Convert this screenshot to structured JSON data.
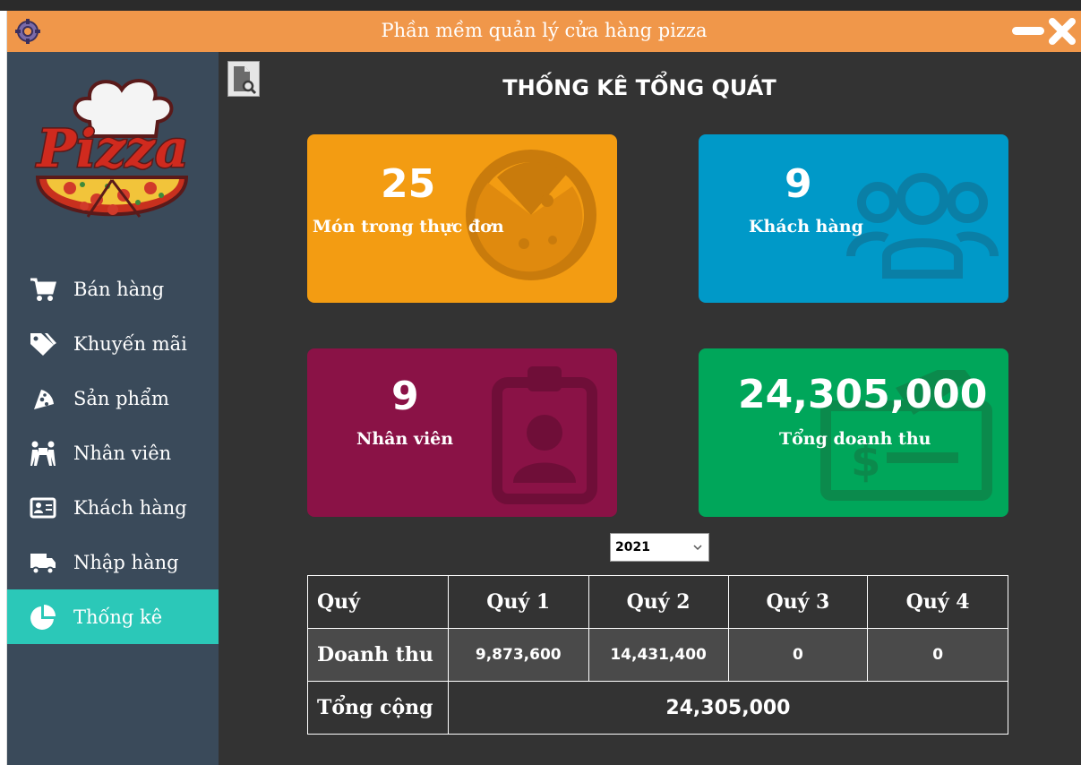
{
  "window": {
    "title": "Phần mềm quản lý cửa hàng pizza",
    "accent_color": "#f0974a"
  },
  "sidebar": {
    "logo_text": "Pizza",
    "items": [
      {
        "label": "Bán hàng",
        "icon": "shopping-cart-icon",
        "active": false
      },
      {
        "label": "Khuyến mãi",
        "icon": "tags-icon",
        "active": false
      },
      {
        "label": "Sản phẩm",
        "icon": "pizza-slice-icon",
        "active": false
      },
      {
        "label": "Nhân viên",
        "icon": "people-carry-icon",
        "active": false
      },
      {
        "label": "Khách hàng",
        "icon": "address-card-icon",
        "active": false
      },
      {
        "label": "Nhập hàng",
        "icon": "truck-icon",
        "active": false
      },
      {
        "label": "Thống kê",
        "icon": "pie-chart-icon",
        "active": true
      }
    ],
    "active_color": "#2bc8b8"
  },
  "main": {
    "heading": "THỐNG KÊ TỔNG QUÁT",
    "cards": [
      {
        "value": "25",
        "label": "Món trong thực đơn",
        "color": "#f39c12",
        "icon": "pizza-icon"
      },
      {
        "value": "9",
        "label": "Khách hàng",
        "color": "#0099c8",
        "icon": "users-icon"
      },
      {
        "value": "9",
        "label": "Nhân viên",
        "color": "#8a1246",
        "icon": "id-badge-icon"
      },
      {
        "value": "24,305,000",
        "label": "Tổng doanh thu",
        "color": "#00a65a",
        "icon": "money-check-icon"
      }
    ],
    "year_select": {
      "value": "2021"
    },
    "table": {
      "header_label": "Quý",
      "quarters": [
        "Quý 1",
        "Quý 2",
        "Quý 3",
        "Quý 4"
      ],
      "revenue_label": "Doanh thu",
      "revenue": [
        "9,873,600",
        "14,431,400",
        "0",
        "0"
      ],
      "total_label": "Tổng cộng",
      "total": "24,305,000"
    }
  }
}
